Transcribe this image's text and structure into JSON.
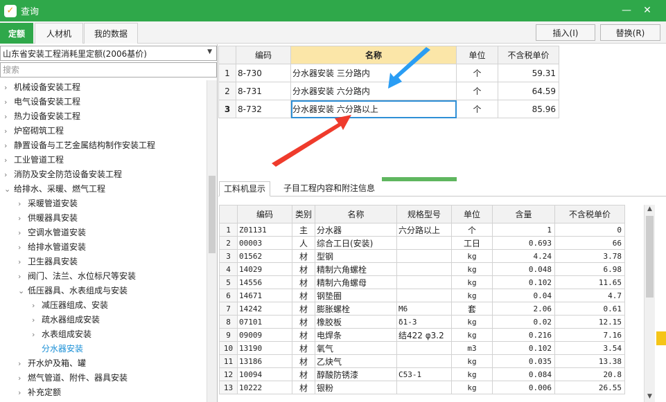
{
  "window": {
    "title": "查询",
    "minimize_glyph": "—",
    "close_glyph": "✕"
  },
  "tabs": [
    "定额",
    "人材机",
    "我的数据"
  ],
  "toolbar": {
    "insert_label": "插入(I)",
    "replace_label": "替换(R)"
  },
  "library": {
    "selected": "山东省安装工程消耗里定额(2006基价)",
    "search_placeholder": "搜索"
  },
  "tree": [
    {
      "label": "机械设备安装工程",
      "level": 0,
      "state": "collapsed"
    },
    {
      "label": "电气设备安装工程",
      "level": 0,
      "state": "collapsed"
    },
    {
      "label": "热力设备安装工程",
      "level": 0,
      "state": "collapsed"
    },
    {
      "label": "炉窑砌筑工程",
      "level": 0,
      "state": "collapsed"
    },
    {
      "label": "静置设备与工艺金属结构制作安装工程",
      "level": 0,
      "state": "collapsed"
    },
    {
      "label": "工业管道工程",
      "level": 0,
      "state": "collapsed"
    },
    {
      "label": "消防及安全防范设备安装工程",
      "level": 0,
      "state": "collapsed"
    },
    {
      "label": "给排水、采暖、燃气工程",
      "level": 0,
      "state": "expanded"
    },
    {
      "label": "采暖管道安装",
      "level": 1,
      "state": "collapsed"
    },
    {
      "label": "供暖器具安装",
      "level": 1,
      "state": "collapsed"
    },
    {
      "label": "空调水管道安装",
      "level": 1,
      "state": "collapsed"
    },
    {
      "label": "给排水管道安装",
      "level": 1,
      "state": "collapsed"
    },
    {
      "label": "卫生器具安装",
      "level": 1,
      "state": "collapsed"
    },
    {
      "label": "阀门、法兰、水位标尺等安装",
      "level": 1,
      "state": "collapsed"
    },
    {
      "label": "低压器具、水表组成与安装",
      "level": 1,
      "state": "expanded"
    },
    {
      "label": "减压器组成、安装",
      "level": 2,
      "state": "collapsed"
    },
    {
      "label": "疏水器组成安装",
      "level": 2,
      "state": "collapsed"
    },
    {
      "label": "水表组成安装",
      "level": 2,
      "state": "collapsed"
    },
    {
      "label": "分水器安装",
      "level": 2,
      "state": "leaf",
      "selected": true
    },
    {
      "label": "开水炉及箱、罐",
      "level": 1,
      "state": "collapsed"
    },
    {
      "label": "燃气管道、附件、器具安装",
      "level": 1,
      "state": "collapsed"
    },
    {
      "label": "补充定额",
      "level": 1,
      "state": "collapsed"
    }
  ],
  "quota_table": {
    "headers": [
      "",
      "编码",
      "名称",
      "单位",
      "不含税单价"
    ],
    "rows": [
      {
        "n": "1",
        "code": "8-730",
        "name": "分水器安装 三分路内",
        "unit": "个",
        "price": "59.31"
      },
      {
        "n": "2",
        "code": "8-731",
        "name": "分水器安装 六分路内",
        "unit": "个",
        "price": "64.59"
      },
      {
        "n": "3",
        "code": "8-732",
        "name": "分水器安装 六分路以上",
        "unit": "个",
        "price": "85.96"
      }
    ]
  },
  "bottom_tabs": [
    "工料机显示",
    "子目工程内容和附注信息"
  ],
  "material_table": {
    "headers": [
      "",
      "编码",
      "类别",
      "名称",
      "规格型号",
      "单位",
      "含量",
      "不含税单价"
    ],
    "rows": [
      [
        "1",
        "Z01131",
        "主",
        "分水器",
        "六分路以上",
        "个",
        "1",
        "0"
      ],
      [
        "2",
        "00003",
        "人",
        "综合工日(安装)",
        "",
        "工日",
        "0.693",
        "66"
      ],
      [
        "3",
        "01562",
        "材",
        "型钢",
        "",
        "kg",
        "4.24",
        "3.78"
      ],
      [
        "4",
        "14029",
        "材",
        "精制六角螺栓",
        "",
        "kg",
        "0.048",
        "6.98"
      ],
      [
        "5",
        "14556",
        "材",
        "精制六角螺母",
        "",
        "kg",
        "0.102",
        "11.65"
      ],
      [
        "6",
        "14671",
        "材",
        "钢垫圈",
        "",
        "kg",
        "0.04",
        "4.7"
      ],
      [
        "7",
        "14242",
        "材",
        "膨胀螺栓",
        "M6",
        "套",
        "2.06",
        "0.61"
      ],
      [
        "8",
        "07101",
        "材",
        "橡胶板",
        "δ1-3",
        "kg",
        "0.02",
        "12.15"
      ],
      [
        "9",
        "09009",
        "材",
        "电焊条",
        "结422 φ3.2",
        "kg",
        "0.216",
        "7.16"
      ],
      [
        "10",
        "13190",
        "材",
        "氧气",
        "",
        "m3",
        "0.102",
        "3.54"
      ],
      [
        "11",
        "13186",
        "材",
        "乙炔气",
        "",
        "kg",
        "0.035",
        "13.38"
      ],
      [
        "12",
        "10094",
        "材",
        "醇酸防锈漆",
        "C53-1",
        "kg",
        "0.084",
        "20.8"
      ],
      [
        "13",
        "10222",
        "材",
        "银粉",
        "",
        "kg",
        "0.006",
        "26.55"
      ]
    ]
  },
  "colors": {
    "accent": "#2fa84a",
    "header_highlight": "#fbe6a8",
    "selection": "#2e8fd6",
    "arrow_blue": "#2a9df4",
    "arrow_red": "#ef3b2c"
  }
}
